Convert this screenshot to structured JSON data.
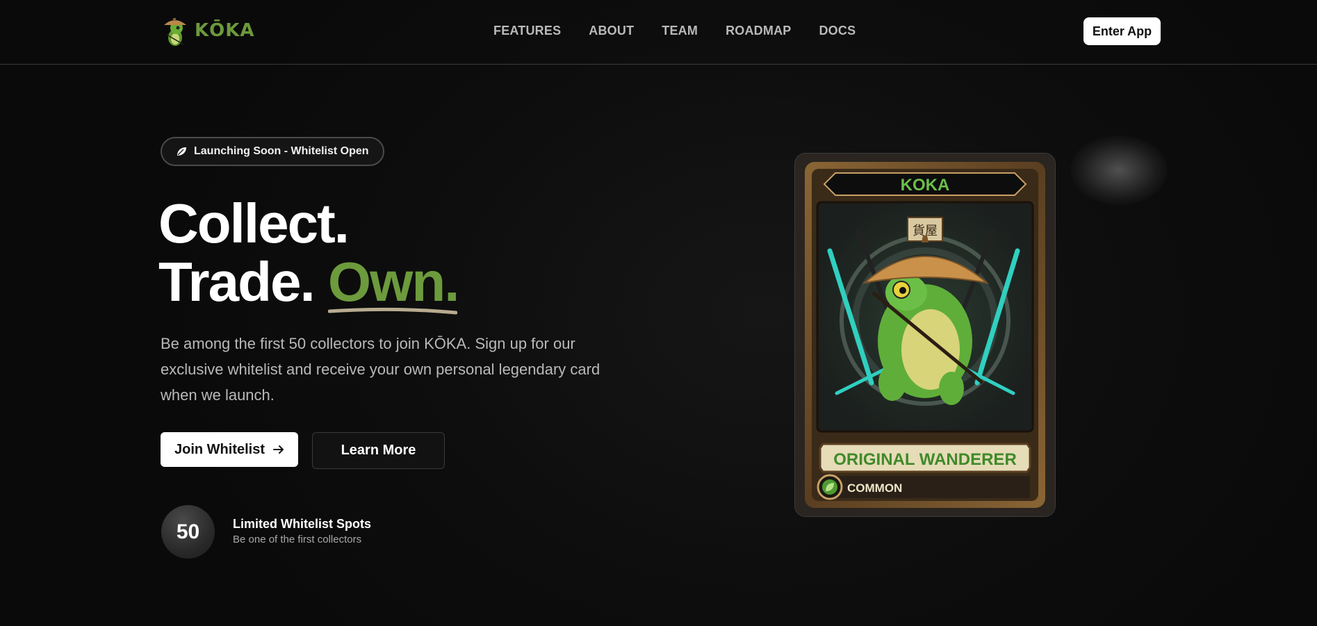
{
  "nav": {
    "brand": "KŌKA",
    "links": [
      "FEATURES",
      "ABOUT",
      "TEAM",
      "ROADMAP",
      "DOCS"
    ],
    "cta": "Enter App"
  },
  "hero": {
    "badge": "Launching Soon - Whitelist Open",
    "headline_line1": "Collect.",
    "headline_line2a": "Trade.",
    "headline_line2b": "Own.",
    "lead": "Be among the first 50 collectors to join KŌKA. Sign up for our exclusive whitelist and receive your own personal legendary card when we launch.",
    "join_label": "Join Whitelist",
    "learn_label": "Learn More",
    "count": "50",
    "count_title": "Limited Whitelist Spots",
    "count_sub": "Be one of the first collectors"
  },
  "card": {
    "name": "KOKA",
    "sign": "貨屋",
    "title": "ORIGINAL WANDERER",
    "rarity": "COMMON"
  },
  "colors": {
    "accent": "#6c9a3c",
    "background": "#0c0c0c",
    "card_frame": "#6b4a25",
    "card_title_text": "#3f8a2a"
  },
  "icons": [
    "frog-logo-icon",
    "leaf-icon",
    "arrow-right-icon",
    "leaf-badge-icon"
  ]
}
